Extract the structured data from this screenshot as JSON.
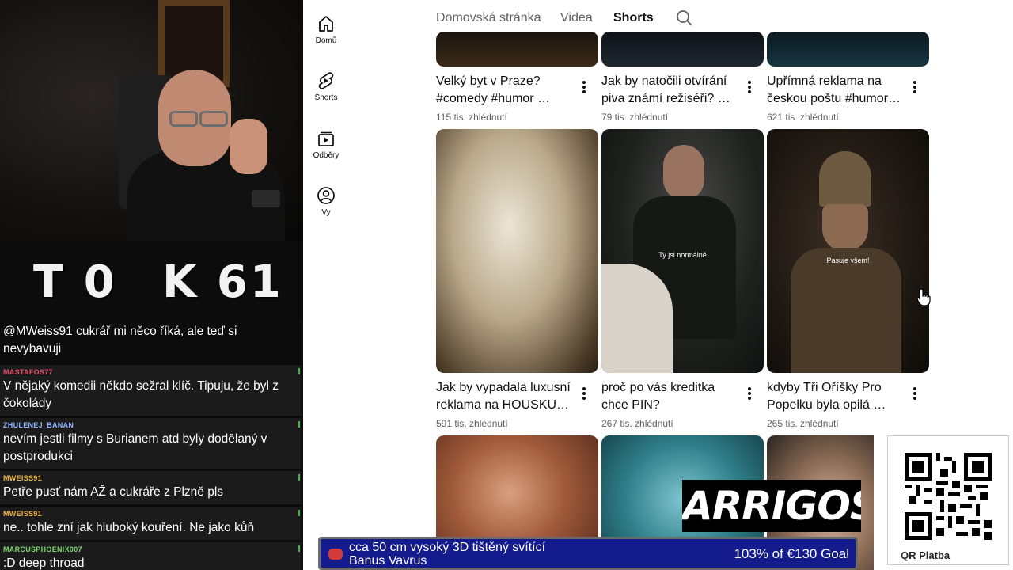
{
  "stream": {
    "counter_left": "T 0",
    "counter_right": "K 61",
    "chat": [
      {
        "user": "",
        "text": "@MWeiss91 cukrář mi něco říká, ale teď si nevybavuji",
        "color": "#ffffff"
      },
      {
        "user": "MASTAFOS77",
        "text": "V nějaký komedii někdo sežral klíč. Tipuju, že byl z čokolády",
        "color": "#e84a6a"
      },
      {
        "user": "ZHULENEJ_BANAN",
        "text": "nevím jestli filmy s Burianem atd byly dodělaný v postprodukci",
        "color": "#8ab4ff"
      },
      {
        "user": "MWEISS91",
        "text": "Petře pusť nám AŽ a cukráře z Plzně pls",
        "color": "#f0b43c"
      },
      {
        "user": "MWEISS91",
        "text": "ne.. tohle zní jak hluboký kouření. Ne jako kůň",
        "color": "#f0b43c"
      },
      {
        "user": "MARCUSPHOENIX007",
        "text": ":D deep throad",
        "color": "#7cd66b"
      }
    ]
  },
  "rail": [
    {
      "label": "Domů",
      "icon": "home-icon"
    },
    {
      "label": "Shorts",
      "icon": "shorts-icon"
    },
    {
      "label": "Odběry",
      "icon": "subscriptions-icon"
    },
    {
      "label": "Vy",
      "icon": "account-icon"
    }
  ],
  "tabs": [
    "Domovská stránka",
    "Videa",
    "Shorts"
  ],
  "active_tab": "Shorts",
  "shorts_row1": [
    {
      "title1": "Velký byt v Praze?",
      "title2": "#comedy  #humor  …",
      "views": "115 tis. zhlédnutí"
    },
    {
      "title1": "Jak by natočili otvírání",
      "title2": "piva známí režiséři?  …",
      "views": "79 tis. zhlédnutí"
    },
    {
      "title1": "Upřímná reklama na",
      "title2": "českou poštu  #humor…",
      "views": "621 tis. zhlédnutí"
    }
  ],
  "shorts_row2": [
    {
      "title1": "Jak by vypadala luxusní",
      "title2": "reklama na HOUSKU? …",
      "views": "591 tis. zhlédnutí",
      "caption": ""
    },
    {
      "title1": "proč po vás kreditka",
      "title2": "chce PIN?",
      "views": "267 tis. zhlédnutí",
      "caption": "Ty jsi normálně"
    },
    {
      "title1": "kdyby Tři Oříšky Pro",
      "title2": "Popelku byla opilá …",
      "views": "265 tis. zhlédnutí",
      "caption": "Pasuje všem!"
    }
  ],
  "overlay": {
    "brand": "ARRIGOS",
    "qr_label": "QR Platba",
    "goal_line1": "cca 50 cm vysoký 3D tištěný svítící",
    "goal_line2": "Banus Vavrus",
    "goal_progress": "103% of €130 Goal"
  }
}
